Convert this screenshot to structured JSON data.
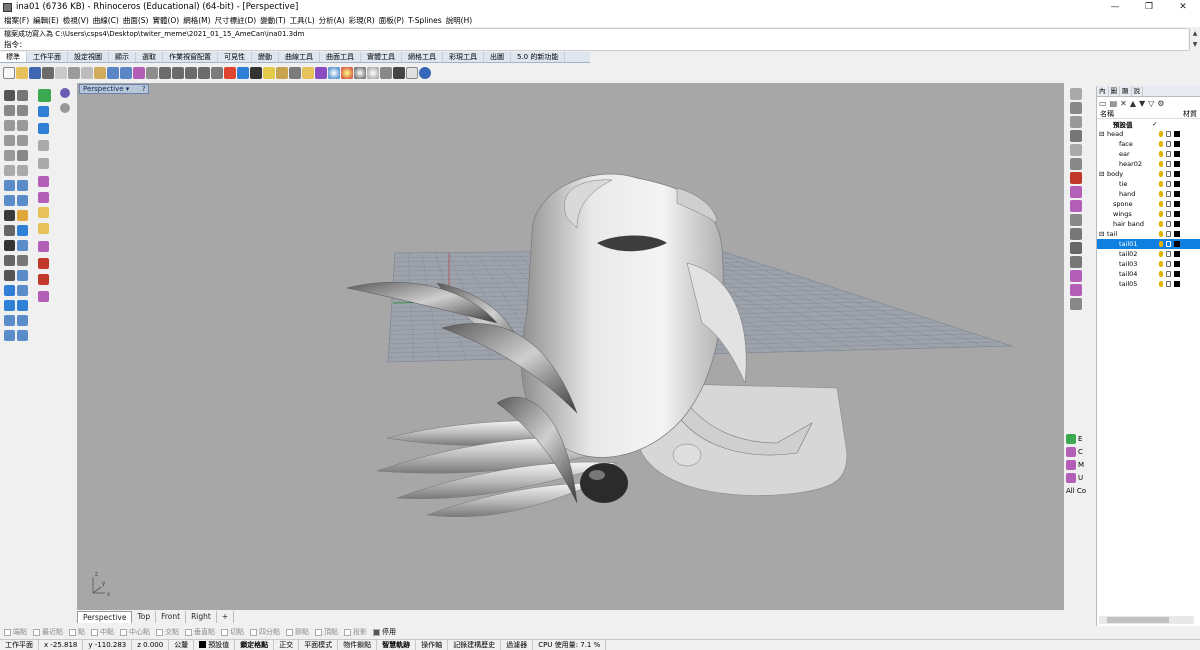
{
  "window": {
    "title": "ina01 (6736 KB) - Rhinoceros (Educational) (64-bit) - [Perspective]",
    "controls": [
      "—",
      "❐",
      "✕"
    ]
  },
  "menu": [
    "檔案(F)",
    "編輯(E)",
    "檢視(V)",
    "曲線(C)",
    "曲面(S)",
    "實體(O)",
    "網格(M)",
    "尺寸標註(D)",
    "變動(T)",
    "工具(L)",
    "分析(A)",
    "彩現(R)",
    "面板(P)",
    "T-Splines",
    "說明(H)"
  ],
  "command": {
    "history": "檔案成功寫入為 C:\\Users\\csps4\\Desktop\\twiter_meme\\2021_01_15_AmeCan\\ina01.3dm",
    "prompt": "指令："
  },
  "toolbar_tabs": [
    "標準",
    "工作平面",
    "設定視圖",
    "顯示",
    "選取",
    "作業視窗配置",
    "可見性",
    "變動",
    "曲線工具",
    "曲面工具",
    "實體工具",
    "網格工具",
    "彩現工具",
    "出圖",
    "5.0 的新功能"
  ],
  "viewport": {
    "title": "Perspective",
    "help": "?",
    "axis_labels": [
      "z",
      "y",
      "x"
    ],
    "tabs": [
      "Perspective",
      "Top",
      "Front",
      "Right"
    ],
    "add_tab": "+"
  },
  "osnaps": [
    {
      "label": "端點",
      "on": false
    },
    {
      "label": "最近點",
      "on": false
    },
    {
      "label": "點",
      "on": false
    },
    {
      "label": "中點",
      "on": false
    },
    {
      "label": "中心點",
      "on": false
    },
    {
      "label": "交點",
      "on": false
    },
    {
      "label": "垂直點",
      "on": false
    },
    {
      "label": "切點",
      "on": false
    },
    {
      "label": "四分點",
      "on": false
    },
    {
      "label": "節點",
      "on": false
    },
    {
      "label": "頂點",
      "on": false
    },
    {
      "label": "投影",
      "on": false
    },
    {
      "label": "停用",
      "on": true
    }
  ],
  "status": {
    "cplane": "工作平面",
    "x": "x -25.818",
    "y": "y -110.283",
    "z": "z 0.000",
    "units": "公釐",
    "layer": "預設值",
    "items": [
      "鎖定格點",
      "正交",
      "平面模式",
      "物件鎖點",
      "智慧軌跡",
      "操作軸",
      "記錄建構歷史",
      "過濾器",
      "CPU 使用量: 7.1 %"
    ]
  },
  "layers_panel": {
    "tab_labels": [
      "內",
      "圖",
      "顯",
      "說"
    ],
    "header": {
      "name": "名稱",
      "material": "材質"
    },
    "rows": [
      {
        "name": "預設值",
        "indent": 1,
        "bold": true,
        "expand": "",
        "check": "✓"
      },
      {
        "name": "head",
        "indent": 0,
        "expand": "⊟"
      },
      {
        "name": "face",
        "indent": 2,
        "expand": ""
      },
      {
        "name": "ear",
        "indent": 2,
        "expand": ""
      },
      {
        "name": "hear02",
        "indent": 2,
        "expand": ""
      },
      {
        "name": "body",
        "indent": 0,
        "expand": "⊟"
      },
      {
        "name": "tie",
        "indent": 2,
        "expand": ""
      },
      {
        "name": "hand",
        "indent": 2,
        "expand": ""
      },
      {
        "name": "spone",
        "indent": 1,
        "expand": ""
      },
      {
        "name": "wings",
        "indent": 1,
        "expand": ""
      },
      {
        "name": "hair band",
        "indent": 1,
        "expand": ""
      },
      {
        "name": "tail",
        "indent": 0,
        "expand": "⊟"
      },
      {
        "name": "tail01",
        "indent": 2,
        "expand": "",
        "selected": true
      },
      {
        "name": "tail02",
        "indent": 2,
        "expand": ""
      },
      {
        "name": "tail03",
        "indent": 2,
        "expand": ""
      },
      {
        "name": "tail04",
        "indent": 2,
        "expand": ""
      },
      {
        "name": "tail05",
        "indent": 2,
        "expand": ""
      }
    ]
  },
  "right_shortcuts": [
    "E",
    "C",
    "M",
    "U",
    "All Co"
  ],
  "colors": {
    "viewport_bg": "#a7a7a7",
    "grid": "#7d8796",
    "selection": "#0f7fe0",
    "model": "#d9d9d9"
  }
}
